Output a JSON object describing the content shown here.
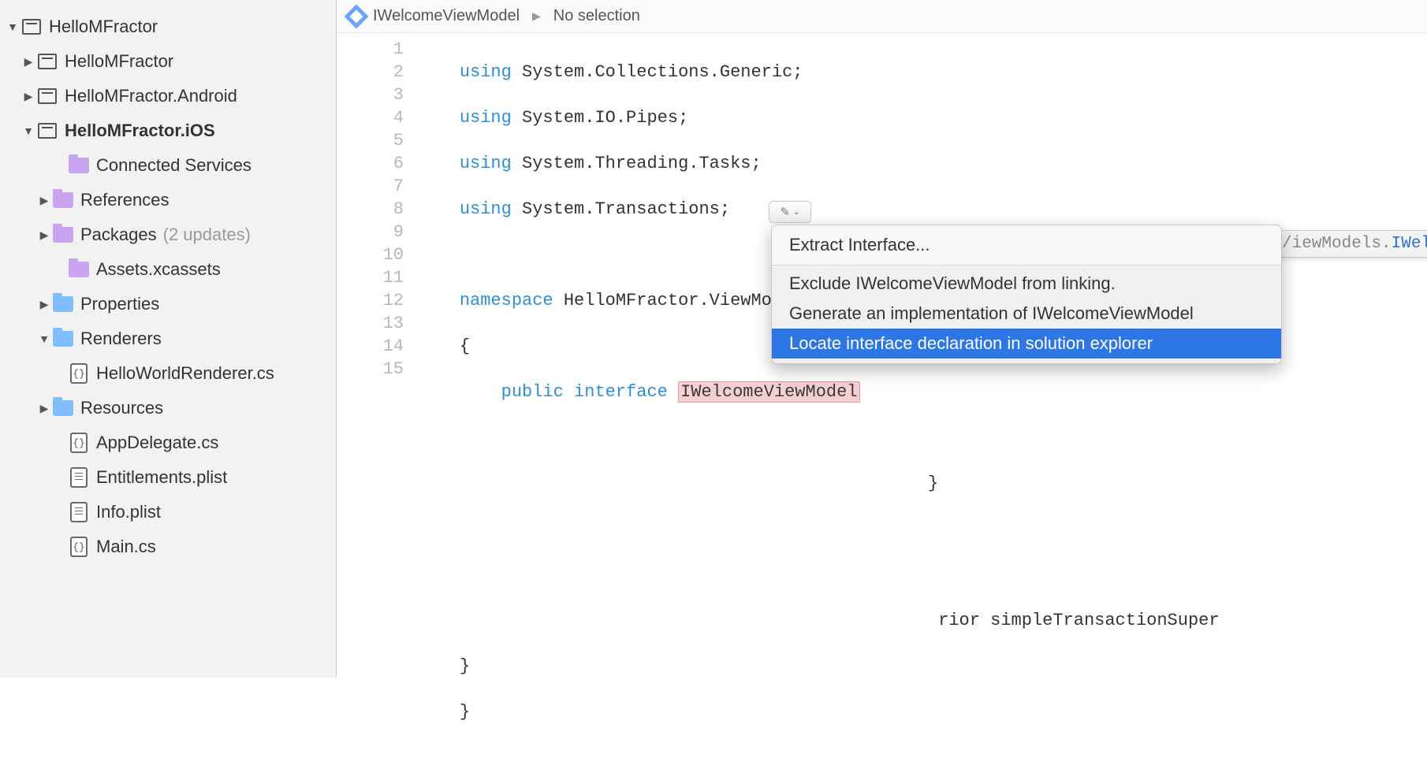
{
  "sidebar": {
    "root": {
      "label": "HelloMFractor"
    },
    "items": [
      {
        "label": "HelloMFractor",
        "type": "project",
        "toggle": "right"
      },
      {
        "label": "HelloMFractor.Android",
        "type": "project",
        "toggle": "right"
      },
      {
        "label": "HelloMFractor.iOS",
        "type": "project",
        "toggle": "down",
        "bold": true
      },
      {
        "label": "Connected Services",
        "type": "purple",
        "indent": 3,
        "toggle": ""
      },
      {
        "label": "References",
        "type": "purple",
        "indent": 2,
        "toggle": "right"
      },
      {
        "label": "Packages",
        "suffix": "(2 updates)",
        "type": "purple",
        "indent": 2,
        "toggle": "right"
      },
      {
        "label": "Assets.xcassets",
        "type": "purple",
        "indent": 3,
        "toggle": ""
      },
      {
        "label": "Properties",
        "type": "folder",
        "indent": 2,
        "toggle": "right"
      },
      {
        "label": "Renderers",
        "type": "folder",
        "indent": 2,
        "toggle": "down"
      },
      {
        "label": "HelloWorldRenderer.cs",
        "type": "cs",
        "indent": 3,
        "toggle": ""
      },
      {
        "label": "Resources",
        "type": "folder",
        "indent": 2,
        "toggle": "right"
      },
      {
        "label": "AppDelegate.cs",
        "type": "cs",
        "indent": 3,
        "toggle": ""
      },
      {
        "label": "Entitlements.plist",
        "type": "plist",
        "indent": 3,
        "toggle": ""
      },
      {
        "label": "Info.plist",
        "type": "plist",
        "indent": 3,
        "toggle": ""
      },
      {
        "label": "Main.cs",
        "type": "cs",
        "indent": 3,
        "toggle": ""
      }
    ]
  },
  "breadcrumb": {
    "item1": "IWelcomeViewModel",
    "item2": "No selection"
  },
  "code": {
    "lines_max": 15,
    "l1_kw": "using",
    "l1_rest": " System.Collections.Generic;",
    "l2_kw": "using",
    "l2_rest": " System.IO.Pipes;",
    "l3_kw": "using",
    "l3_rest": " System.Threading.Tasks;",
    "l4_kw": "using",
    "l4_rest": " System.Transactions;",
    "l6_kw": "namespace",
    "l6_rest": " HelloMFractor.ViewModels",
    "l7": "{",
    "l8_kw1": "public",
    "l8_kw2": "interface",
    "l8_type": "IWelcomeViewModel",
    "l9": "    {",
    "l11": "    }",
    "l13_a": "rior simpleTransactionSuper",
    "l14": "}",
    "l15": "}",
    "close_brace": "}"
  },
  "popup": {
    "header": "Extract Interface...",
    "item1": "Exclude IWelcomeViewModel from linking.",
    "item2": "Generate an implementation of IWelcomeViewModel",
    "item3": "Locate interface declaration in solution explorer"
  },
  "tooltip": {
    "gray": "/iewModels.",
    "blue": "IWelcomeViewModel"
  }
}
